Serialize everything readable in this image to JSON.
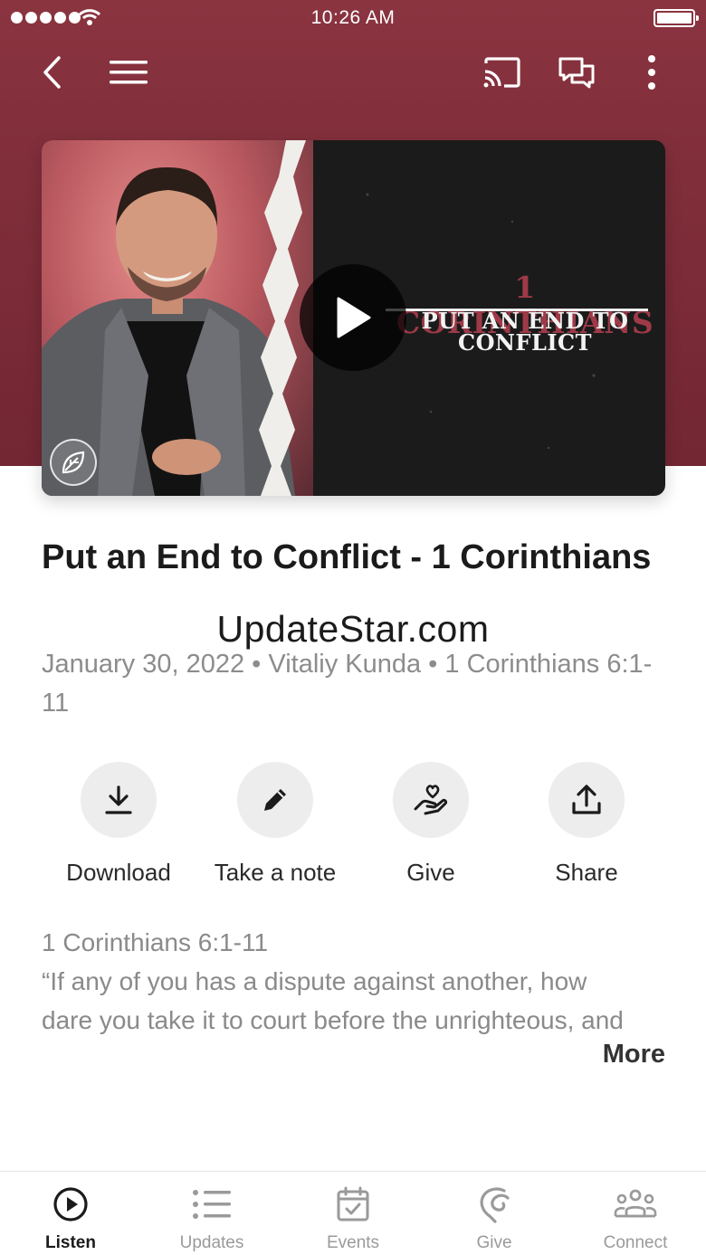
{
  "status_bar": {
    "time": "10:26 AM"
  },
  "nav": {
    "back": "back-icon",
    "menu": "menu-icon",
    "cast": "cast-icon",
    "chat": "chat-icon",
    "more": "more-vertical-icon"
  },
  "thumbnail": {
    "series_title": "1 CORINTHIANS",
    "series_subtitle_line1": "PUT AN END TO",
    "series_subtitle_line2": "CONFLICT"
  },
  "sermon": {
    "title": "Put an End to Conflict - 1 Corinthians",
    "meta": "January 30, 2022 • Vitaliy Kunda • 1 Corinthians 6:1-11"
  },
  "watermark": "UpdateStar.com",
  "actions": [
    {
      "label": "Download",
      "icon": "download-icon"
    },
    {
      "label": "Take a note",
      "icon": "pencil-icon"
    },
    {
      "label": "Give",
      "icon": "give-heart-hand-icon"
    },
    {
      "label": "Share",
      "icon": "share-icon"
    }
  ],
  "description": {
    "reference": "1 Corinthians 6:1-11",
    "text": "“If any of you has a dispute against another, how dare you take it to court before the unrighteous, and",
    "more_label": "More"
  },
  "tabs": [
    {
      "label": "Listen",
      "icon": "play-circle-icon",
      "active": true
    },
    {
      "label": "Updates",
      "icon": "list-icon",
      "active": false
    },
    {
      "label": "Events",
      "icon": "calendar-icon",
      "active": false
    },
    {
      "label": "Give",
      "icon": "give-icon",
      "active": false
    },
    {
      "label": "Connect",
      "icon": "people-icon",
      "active": false
    }
  ],
  "colors": {
    "hero": "#7e2d39",
    "accent_red": "#9e3a48",
    "text_muted": "#8c8c8c"
  }
}
